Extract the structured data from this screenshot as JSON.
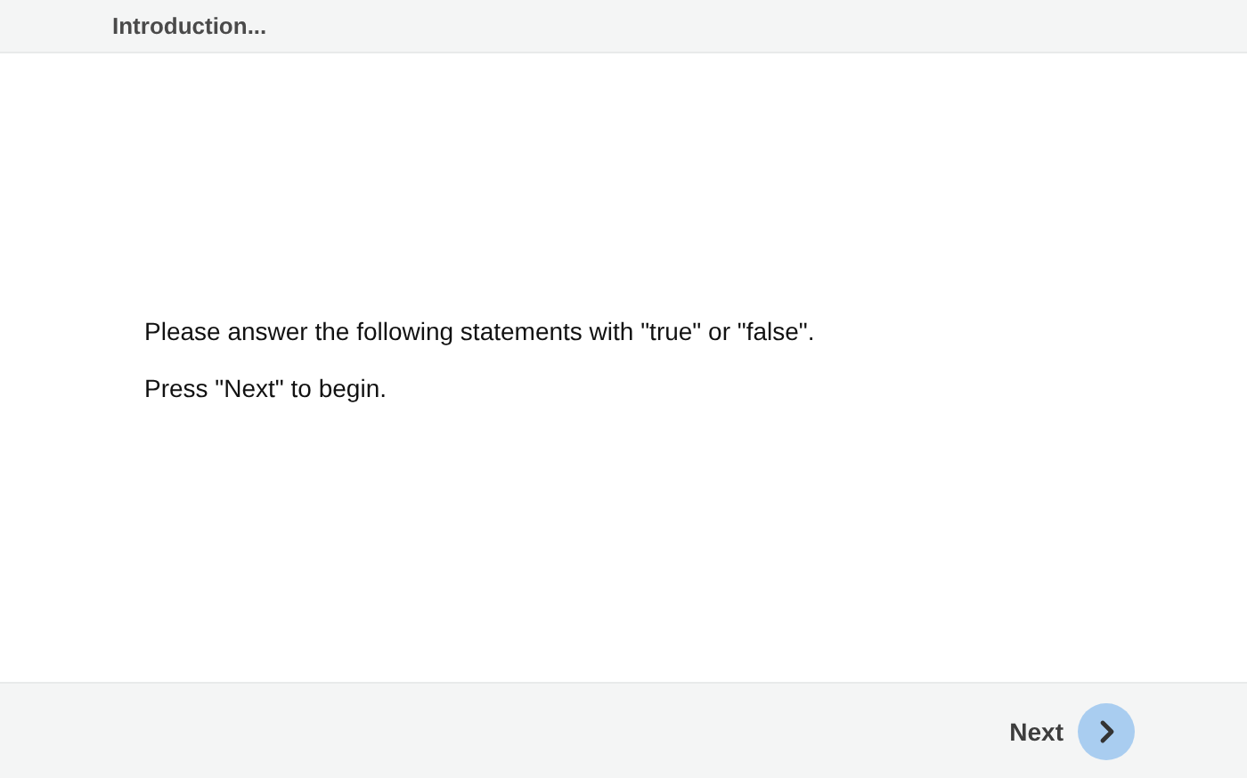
{
  "header": {
    "title": "Introduction..."
  },
  "content": {
    "paragraphs": [
      "Please answer the following statements with \"true\" or \"false\".",
      "Press \"Next\" to begin."
    ]
  },
  "footer": {
    "next_button": {
      "label": "Next"
    }
  }
}
